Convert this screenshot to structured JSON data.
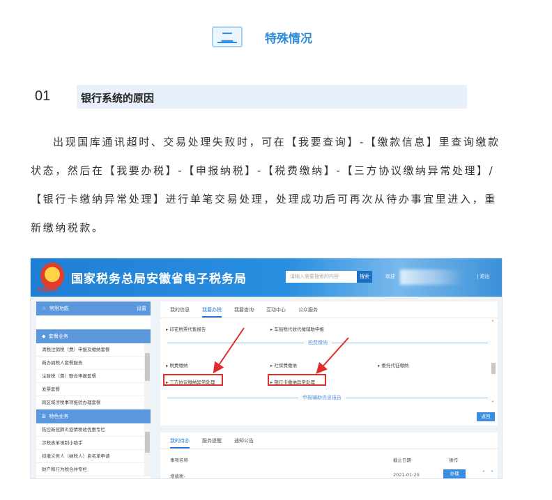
{
  "section": {
    "number": "二",
    "title": "特殊情况"
  },
  "subsection": {
    "number": "01",
    "title": "银行系统的原因"
  },
  "paragraph": "出现国库通讯超时、交易处理失败时，可在【我要查询】-【缴款信息】里查询缴款状态，然后在【我要办税】-【申报纳税】-【税费缴纳】-【三方协议缴纳异常处理】/【银行卡缴纳异常处理】进行单笔交易处理，处理成功后可再次从待办事宜里进入，重新缴纳税款。",
  "screenshot": {
    "brand": "国家税务总局安徽省电子税务局",
    "emblem_text": "中国税务",
    "search_placeholder": "请输入需要搜索的内容",
    "search_button": "搜索",
    "welcome": "欢迎",
    "logout": "| 退出",
    "left_panel": {
      "common_title": "常用功能",
      "settings": "设置",
      "package_title": "套餐业务",
      "package_items": [
        "清税注销税（费）申报及缴纳套餐",
        "新办纳税人套餐服务",
        "注财税（费）联合申报套餐",
        "发票套餐",
        "跨区域涉税事项报验办理套餐"
      ],
      "feature_title": "特色业务",
      "feature_items": [
        "防控新冠肺炎疫情税收优惠专栏",
        "涉税表单填制小助手",
        "扣缴义务人（纳税人）自名单申请",
        "财产和行为税合并专栏"
      ]
    },
    "tabs": [
      "我的信息",
      "我要办税",
      "我要查询",
      "互动中心",
      "公众服务"
    ],
    "active_tab": "我要办税",
    "items": {
      "print_stamp": "印花税票代售报告",
      "vehicle_tax": "车船税代收代缴辅助申报",
      "tax_payment_section": "税费缴纳",
      "tax_payment": "税费缴纳",
      "social_security": "社保费缴纳",
      "entrusted": "委托代征缴纳",
      "tripartite_exception": "三方协议缴纳异常处理",
      "bank_card_exception": "银行卡缴纳异常处理",
      "declaration_aux": "申报辅助信息报告"
    },
    "back_button": "返回",
    "bottom_tabs": [
      "我的待办",
      "服务提醒",
      "通知公告"
    ],
    "table": {
      "col_name": "事项名称",
      "col_deadline": "截止日期",
      "col_action": "操作",
      "row_name": "增值税-",
      "row_deadline": "2021-01-20",
      "row_action": "办理"
    }
  }
}
